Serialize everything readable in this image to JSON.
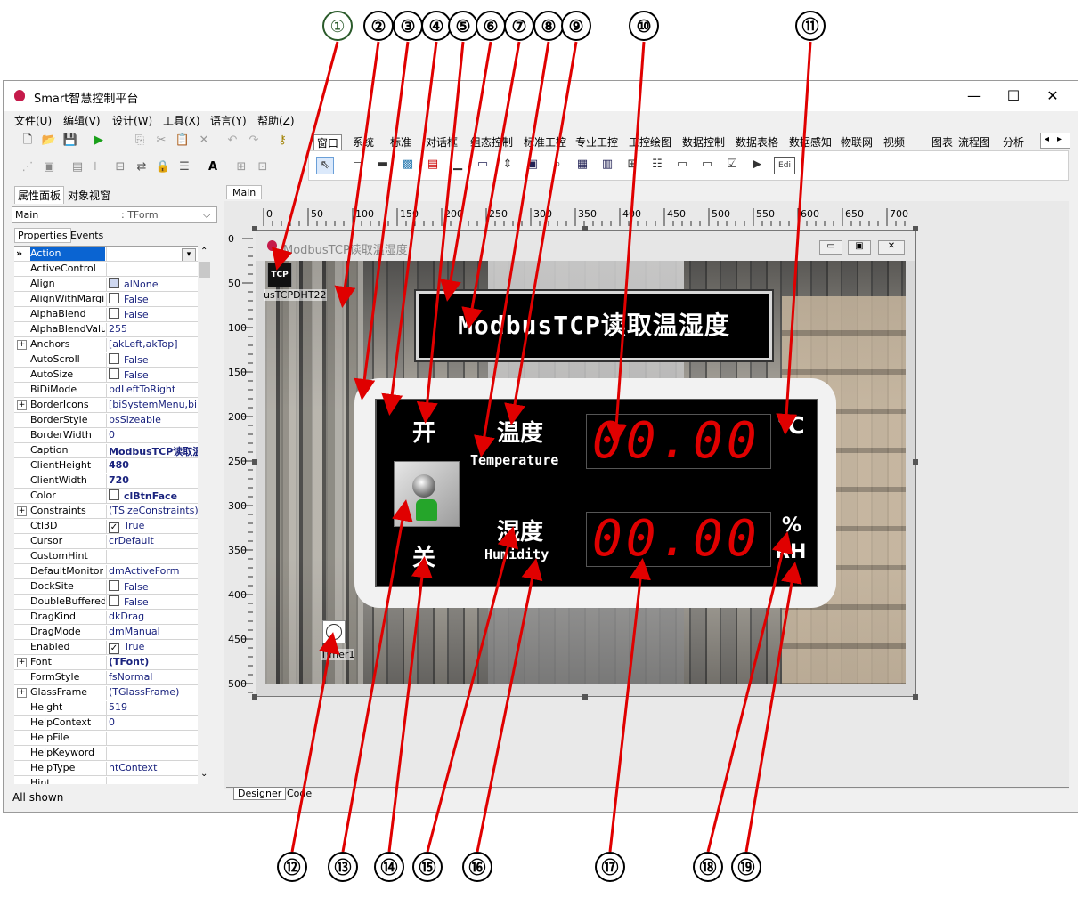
{
  "callouts": [
    "①",
    "②",
    "③",
    "④",
    "⑤",
    "⑥",
    "⑦",
    "⑧",
    "⑨",
    "⑩",
    "⑪",
    "⑫",
    "⑬",
    "⑭",
    "⑮",
    "⑯",
    "⑰",
    "⑱",
    "⑲"
  ],
  "window": {
    "title": "Smart智慧控制平台",
    "minimize": "—",
    "maximize": "☐",
    "close": "✕"
  },
  "menu": [
    "文件(U)",
    "编辑(V)",
    "设计(W)",
    "工具(X)",
    "语言(Y)",
    "帮助(Z)"
  ],
  "palette_tabs": [
    "窗口",
    "系统",
    "标准",
    "对话框",
    "组态控制",
    "标准工控",
    "专业工控",
    "工控绘图",
    "数据控制",
    "数据表格",
    "数据感知",
    "物联网",
    "视频",
    "图表",
    "流程图",
    "分析"
  ],
  "left_panel": {
    "tabs": [
      "属性面板",
      "对象视窗"
    ],
    "combo_name": "Main",
    "combo_type": ": TForm",
    "subtabs": [
      "Properties",
      "Events"
    ],
    "status": "All shown",
    "properties": [
      {
        "name": "Action",
        "value": "",
        "sel": true,
        "dropdown": true
      },
      {
        "name": "ActiveControl",
        "value": ""
      },
      {
        "name": "Align",
        "value": "alNone",
        "icon": "align-icon"
      },
      {
        "name": "AlignWithMargins",
        "value": "False",
        "check": false
      },
      {
        "name": "AlphaBlend",
        "value": "False",
        "check": false
      },
      {
        "name": "AlphaBlendValue",
        "value": "255"
      },
      {
        "name": "Anchors",
        "value": "[akLeft,akTop]",
        "expand": true
      },
      {
        "name": "AutoScroll",
        "value": "False",
        "check": false
      },
      {
        "name": "AutoSize",
        "value": "False",
        "check": false
      },
      {
        "name": "BiDiMode",
        "value": "bdLeftToRight"
      },
      {
        "name": "BorderIcons",
        "value": "[biSystemMenu,biMini",
        "expand": true
      },
      {
        "name": "BorderStyle",
        "value": "bsSizeable"
      },
      {
        "name": "BorderWidth",
        "value": "0"
      },
      {
        "name": "Caption",
        "value": "ModbusTCP读取温",
        "bold": true
      },
      {
        "name": "ClientHeight",
        "value": "480",
        "bold": true
      },
      {
        "name": "ClientWidth",
        "value": "720",
        "bold": true
      },
      {
        "name": "Color",
        "value": "clBtnFace",
        "bold": true,
        "swatch": true
      },
      {
        "name": "Constraints",
        "value": "(TSizeConstraints)",
        "expand": true
      },
      {
        "name": "Ctl3D",
        "value": "True",
        "check": true
      },
      {
        "name": "Cursor",
        "value": "crDefault"
      },
      {
        "name": "CustomHint",
        "value": ""
      },
      {
        "name": "DefaultMonitor",
        "value": "dmActiveForm"
      },
      {
        "name": "DockSite",
        "value": "False",
        "check": false
      },
      {
        "name": "DoubleBuffered",
        "value": "False",
        "check": false
      },
      {
        "name": "DragKind",
        "value": "dkDrag"
      },
      {
        "name": "DragMode",
        "value": "dmManual"
      },
      {
        "name": "Enabled",
        "value": "True",
        "check": true
      },
      {
        "name": "Font",
        "value": "(TFont)",
        "bold": true,
        "expand": true
      },
      {
        "name": "FormStyle",
        "value": "fsNormal"
      },
      {
        "name": "GlassFrame",
        "value": "(TGlassFrame)",
        "expand": true
      },
      {
        "name": "Height",
        "value": "519"
      },
      {
        "name": "HelpContext",
        "value": "0"
      },
      {
        "name": "HelpFile",
        "value": ""
      },
      {
        "name": "HelpKeyword",
        "value": ""
      },
      {
        "name": "HelpType",
        "value": "htContext"
      },
      {
        "name": "Hint",
        "value": ""
      }
    ]
  },
  "designer": {
    "tab": "Main",
    "bottom_tabs": [
      "Designer",
      "Code"
    ],
    "ruler_h": [
      "0",
      "50",
      "100",
      "150",
      "200",
      "250",
      "300",
      "350",
      "400",
      "450",
      "500",
      "550",
      "600",
      "650",
      "700"
    ],
    "ruler_v": [
      "0",
      "50",
      "100",
      "150",
      "200",
      "250",
      "300",
      "350",
      "400",
      "450",
      "500"
    ],
    "form_caption": "ModbusTCP读取温湿度",
    "tcp_label": "TCP",
    "tcp_name": "usTCPDHT22",
    "timer_name": "Timer1",
    "heading": "ModbusTCP读取温湿度",
    "switch_on": "开",
    "switch_off": "关",
    "temp_cn": "温度",
    "temp_en": "Temperature",
    "hum_cn": "湿度",
    "hum_en": "Humidity",
    "temp_value": "00.00",
    "hum_value": "00.00",
    "temp_unit": "℃",
    "hum_unit_1": "%",
    "hum_unit_2": "RH"
  },
  "colors": {
    "digit": "#e00000",
    "selection": "#0a64d2",
    "arrow": "#e00000"
  }
}
